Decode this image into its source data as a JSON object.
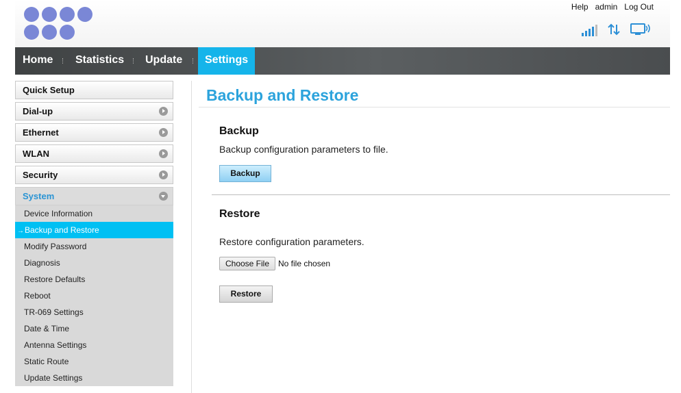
{
  "header": {
    "links": {
      "help": "Help",
      "user": "admin",
      "logout": "Log Out"
    },
    "icons": [
      "signal-strength-icon",
      "data-transfer-icon",
      "monitor-wifi-icon"
    ],
    "accent_color": "#2c8fd6",
    "logo_color": "#7a87d6"
  },
  "nav": {
    "items": [
      "Home",
      "Statistics",
      "Update",
      "Settings"
    ],
    "active": "Settings",
    "active_color": "#15b4ea"
  },
  "sidebar": {
    "menus": [
      "Quick Setup",
      "Dial-up",
      "Ethernet",
      "WLAN",
      "Security",
      "System"
    ],
    "expanded": "System",
    "submenu": [
      "Device Information",
      "Backup and Restore",
      "Modify Password",
      "Diagnosis",
      "Restore Defaults",
      "Reboot",
      "TR-069 Settings",
      "Date & Time",
      "Antenna Settings",
      "Static Route",
      "Update Settings"
    ],
    "active_submenu": "Backup and Restore",
    "active_color": "#00c0f3"
  },
  "main": {
    "title": "Backup and Restore",
    "backup": {
      "heading": "Backup",
      "description": "Backup configuration parameters to file.",
      "button": "Backup"
    },
    "restore": {
      "heading": "Restore",
      "description": "Restore configuration parameters.",
      "choose_file": "Choose File",
      "file_status": "No file chosen",
      "button": "Restore"
    }
  }
}
